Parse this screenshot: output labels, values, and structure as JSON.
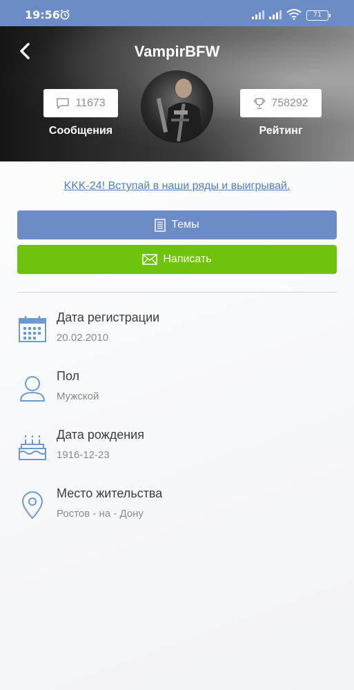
{
  "status_bar": {
    "time": "19:56",
    "battery": "71"
  },
  "header": {
    "username": "VampirBFW",
    "messages_count": "11673",
    "messages_label": "Сообщения",
    "rating_value": "758292",
    "rating_label": "Рейтинг"
  },
  "promo": {
    "link_text": "KKK-24! Вступай в наши ряды и выигрывай."
  },
  "buttons": {
    "topics_label": "Темы",
    "write_label": "Написать"
  },
  "info": {
    "registration": {
      "title": "Дата регистрации",
      "value": "20.02.2010"
    },
    "gender": {
      "title": "Пол",
      "value": "Мужской"
    },
    "birthdate": {
      "title": "Дата рождения",
      "value": "1916-12-23"
    },
    "location": {
      "title": "Место жительства",
      "value": "Ростов - на - Дону"
    }
  },
  "colors": {
    "accent_blue": "#6b8cc7",
    "accent_green": "#6dc40a",
    "link_blue": "#4e7fc1"
  },
  "icons": {
    "alarm": "alarm-clock-icon",
    "back": "chevron-left-icon",
    "messages": "speech-bubble-icon",
    "rating": "trophy-icon",
    "topics": "document-list-icon",
    "write": "envelope-icon",
    "registration": "calendar-icon",
    "gender": "person-icon",
    "birthdate": "birthday-cake-icon",
    "location": "map-pin-icon"
  }
}
